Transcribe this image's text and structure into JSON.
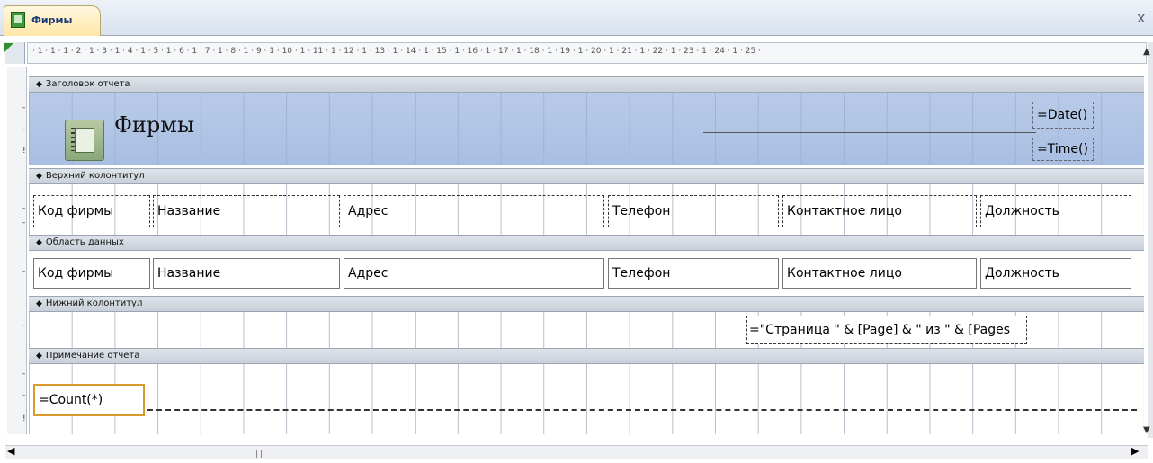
{
  "tab": {
    "label": "Фирмы",
    "close": "x"
  },
  "ruler": {
    "marks": "· 1 · 1 · 1 · 2 · 1 · 3 · 1 · 4 · 1 · 5 · 1 · 6 · 1 · 7 · 1 · 8 · 1 · 9 · 1 · 10 · 1 · 11 · 1 · 12 · 1 · 13 · 1 · 14 · 1 · 15 · 1 · 16 · 1 · 17 · 1 · 18 · 1 · 19 · 1 · 20 · 1 · 21 · 1 · 22 · 1 · 23 · 1 · 24 · 1 · 25 ·"
  },
  "sections": {
    "report_header": {
      "label": "Заголовок отчета",
      "title": "Фирмы",
      "date": "=Date()",
      "time": "=Time()"
    },
    "page_header": {
      "label": "Верхний колонтитул",
      "fields": [
        "Код фирмы",
        "Название",
        "Адрес",
        "Телефон",
        "Контактное лицо",
        "Должность"
      ]
    },
    "detail": {
      "label": "Область данных",
      "fields": [
        "Код фирмы",
        "Название",
        "Адрес",
        "Телефон",
        "Контактное лицо",
        "Должность"
      ]
    },
    "page_footer": {
      "label": "Нижний колонтитул",
      "page_expr": "=\"Страница \" & [Page] & \" из \" & [Pages"
    },
    "report_footer": {
      "label": "Примечание отчета",
      "count_expr": "=Count(*)"
    }
  },
  "icons": {
    "tab": "report-icon",
    "title": "report-form-icon",
    "band_arrow": "band-arrow-icon"
  },
  "colors": {
    "header_band": "#c9d8ef",
    "selection": "#d79a2c",
    "tab": "#ffe7a8"
  }
}
